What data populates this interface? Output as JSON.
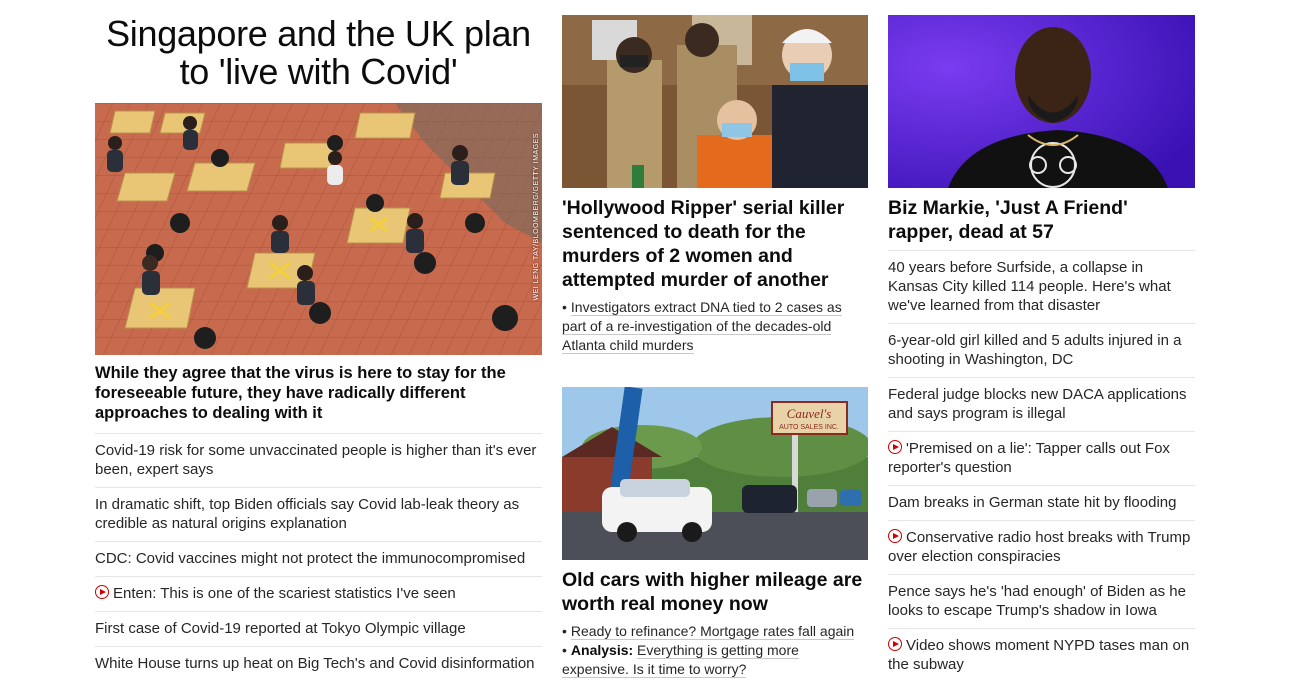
{
  "col1": {
    "title": "Singapore and the UK plan to 'live with Covid'",
    "photo_credit": "WEI LENG TAY/BLOOMBERG/GETTY IMAGES",
    "summary": "While they agree that the virus is here to stay for the foreseeable future, they have radically different approaches to dealing with it",
    "links": [
      {
        "text": "Covid-19 risk for some unvaccinated people is higher than it's ever been, expert says",
        "video": false
      },
      {
        "text": "In dramatic shift, top Biden officials say Covid lab-leak theory as credible as natural origins explanation",
        "video": false
      },
      {
        "text": "CDC: Covid vaccines might not protect the immunocompromised",
        "video": false
      },
      {
        "text": "Enten: This is one of the scariest statistics I've seen",
        "video": true
      },
      {
        "text": "First case of Covid-19 reported at Tokyo Olympic village",
        "video": false
      },
      {
        "text": "White House turns up heat on Big Tech's and Covid disinformation",
        "video": false
      }
    ]
  },
  "col2": {
    "story1": {
      "title": "'Hollywood Ripper' serial killer sentenced to death for the murders of 2 women and attempted murder of another",
      "related": "Investigators extract DNA tied to 2 cases as part of a re-investigation of the decades-old Atlanta child murders"
    },
    "story2": {
      "title": "Old cars with higher mileage are worth real money now",
      "sign_text": "Cauvel's",
      "sign_subtext": "AUTO SALES INC.",
      "related1": "Ready to refinance? Mortgage rates fall again",
      "related2_label": "Analysis:",
      "related2": "Everything is getting more expensive. Is it time to worry?"
    }
  },
  "col3": {
    "title": "Biz Markie, 'Just A Friend' rapper, dead at 57",
    "links": [
      {
        "text": "40 years before Surfside, a collapse in Kansas City killed 114 people. Here's what we've learned from that disaster",
        "video": false
      },
      {
        "text": "6-year-old girl killed and 5 adults injured in a shooting in Washington, DC",
        "video": false
      },
      {
        "text": "Federal judge blocks new DACA applications and says program is illegal",
        "video": false
      },
      {
        "text": "'Premised on a lie': Tapper calls out Fox reporter's question",
        "video": true
      },
      {
        "text": "Dam breaks in German state hit by flooding",
        "video": false
      },
      {
        "text": "Conservative radio host breaks with Trump over election conspiracies",
        "video": true
      },
      {
        "text": "Pence says he's 'had enough' of Biden as he looks to escape Trump's shadow in Iowa",
        "video": false
      },
      {
        "text": "Video shows moment NYPD tases man on the subway",
        "video": true
      }
    ]
  },
  "colors": {
    "accent_red": "#cc0000",
    "divider": "#e6e6e6"
  }
}
